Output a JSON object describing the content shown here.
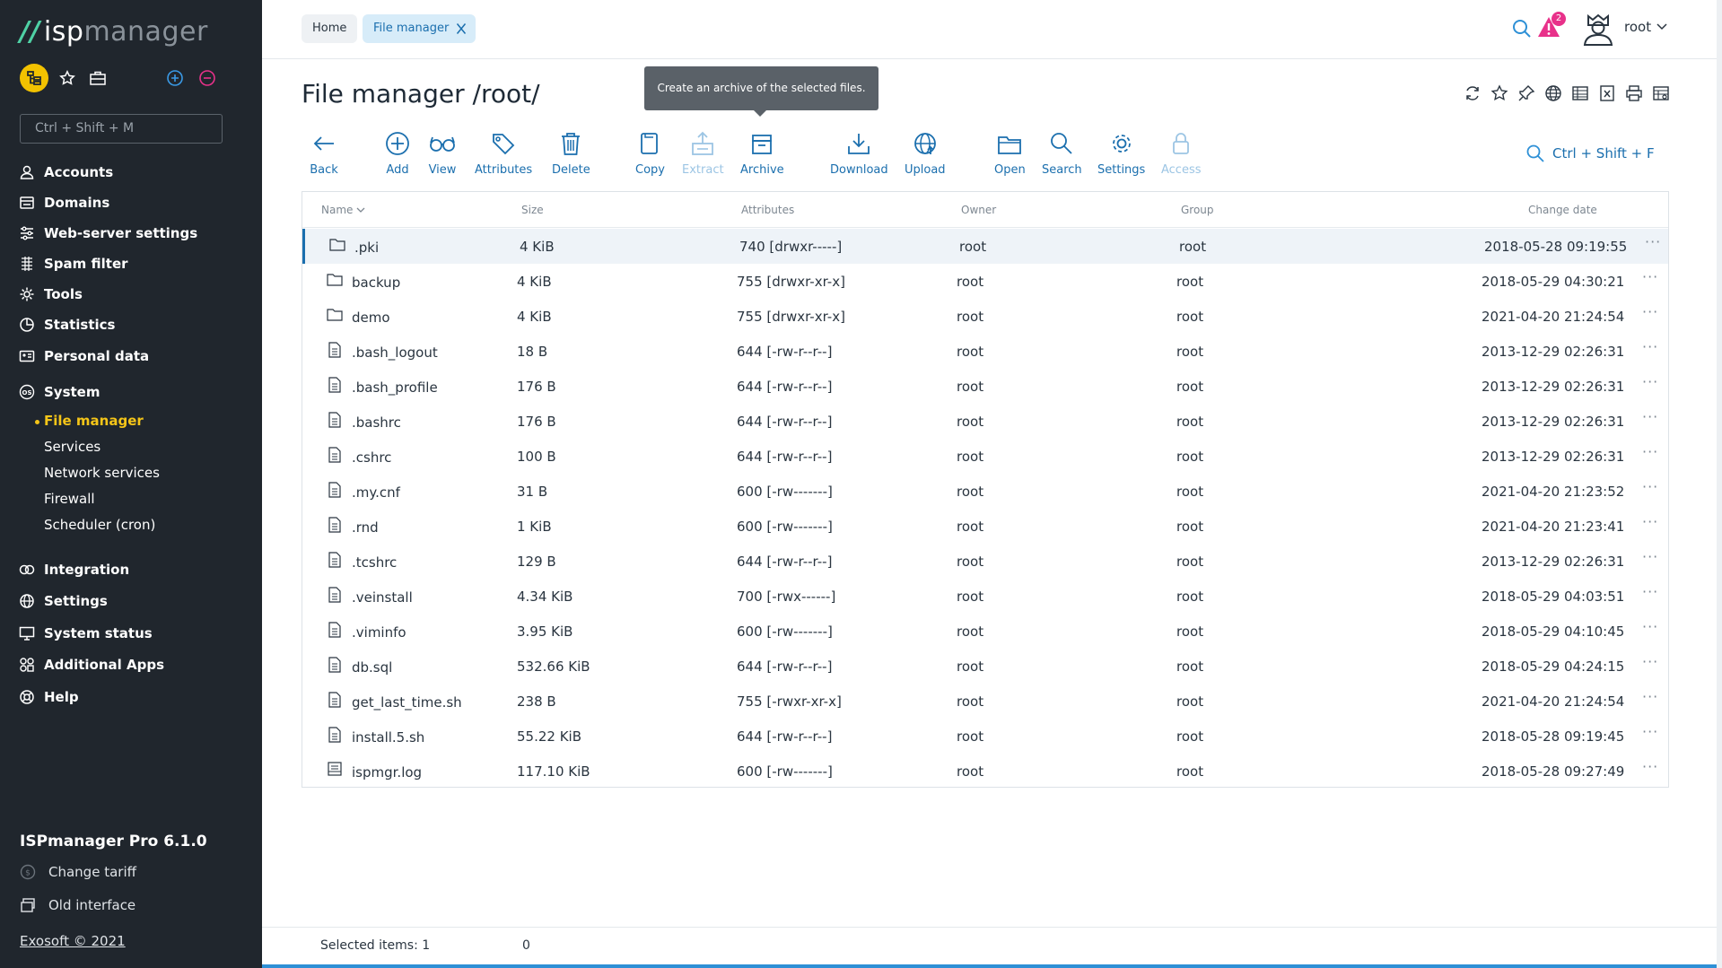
{
  "app": {
    "logo_isp": "isp",
    "logo_mgr": "manager",
    "search_placeholder": "Ctrl + Shift + M",
    "product": "ISPmanager Pro 6.1.0",
    "change_tariff": "Change tariff",
    "old_interface": "Old interface",
    "copyright": "Exosoft © 2021",
    "accent_color": "#f5c518",
    "link_color": "#1b6fae"
  },
  "menu": {
    "items": [
      {
        "label": "Accounts",
        "icon": "user-icon"
      },
      {
        "label": "Domains",
        "icon": "domains-icon"
      },
      {
        "label": "Web-server settings",
        "icon": "sliders-icon"
      },
      {
        "label": "Spam filter",
        "icon": "filter-icon"
      },
      {
        "label": "Tools",
        "icon": "gear-icon"
      },
      {
        "label": "Statistics",
        "icon": "pie-chart-icon"
      },
      {
        "label": "Personal data",
        "icon": "id-card-icon"
      },
      {
        "label": "System",
        "icon": "os-icon"
      },
      {
        "label": "Integration",
        "icon": "toggle-icon"
      },
      {
        "label": "Settings",
        "icon": "globe-gear-icon"
      },
      {
        "label": "System status",
        "icon": "monitor-icon"
      },
      {
        "label": "Additional Apps",
        "icon": "apps-icon"
      },
      {
        "label": "Help",
        "icon": "lifebuoy-icon"
      }
    ],
    "system_sub": [
      {
        "label": "File manager",
        "active": true
      },
      {
        "label": "Services",
        "active": false
      },
      {
        "label": "Network services",
        "active": false
      },
      {
        "label": "Firewall",
        "active": false
      },
      {
        "label": "Scheduler (cron)",
        "active": false
      }
    ]
  },
  "tabs": [
    {
      "label": "Home"
    },
    {
      "label": "File manager"
    }
  ],
  "user": {
    "name": "root",
    "alerts": "2"
  },
  "page": {
    "title": "File manager /root/",
    "tooltip": "Create an archive of the selected files.",
    "find_shortcut": "Ctrl + Shift + F"
  },
  "toolbar": [
    {
      "label": "Back",
      "icon": "arrow-left-icon",
      "disabled": false
    },
    {
      "label": "Add",
      "icon": "plus-circle-icon",
      "disabled": false
    },
    {
      "label": "View",
      "icon": "glasses-icon",
      "disabled": false
    },
    {
      "label": "Attributes",
      "icon": "tags-icon",
      "disabled": false
    },
    {
      "label": "Delete",
      "icon": "trash-icon",
      "disabled": false
    },
    {
      "label": "Copy",
      "icon": "copy-icon",
      "disabled": false
    },
    {
      "label": "Extract",
      "icon": "extract-icon",
      "disabled": true
    },
    {
      "label": "Archive",
      "icon": "archive-icon",
      "disabled": false
    },
    {
      "label": "Download",
      "icon": "download-icon",
      "disabled": false
    },
    {
      "label": "Upload",
      "icon": "upload-icon",
      "disabled": false
    },
    {
      "label": "Open",
      "icon": "folder-open-icon",
      "disabled": false
    },
    {
      "label": "Search",
      "icon": "search-icon",
      "disabled": false
    },
    {
      "label": "Settings",
      "icon": "gear-icon",
      "disabled": false
    },
    {
      "label": "Access",
      "icon": "lock-icon",
      "disabled": true
    }
  ],
  "table": {
    "columns": [
      "Name",
      "Size",
      "Attributes",
      "Owner",
      "Group",
      "Change date"
    ],
    "rows": [
      {
        "name": ".pki",
        "type": "folder",
        "size": "4 KiB",
        "attrs": "740 [drwxr-----]",
        "owner": "root",
        "group": "root",
        "date": "2018-05-28 09:19:55",
        "selected": true
      },
      {
        "name": "backup",
        "type": "folder",
        "size": "4 KiB",
        "attrs": "755 [drwxr-xr-x]",
        "owner": "root",
        "group": "root",
        "date": "2018-05-29 04:30:21"
      },
      {
        "name": "demo",
        "type": "folder",
        "size": "4 KiB",
        "attrs": "755 [drwxr-xr-x]",
        "owner": "root",
        "group": "root",
        "date": "2021-04-20 21:24:54"
      },
      {
        "name": ".bash_logout",
        "type": "file",
        "size": "18 B",
        "attrs": "644 [-rw-r--r--]",
        "owner": "root",
        "group": "root",
        "date": "2013-12-29 02:26:31"
      },
      {
        "name": ".bash_profile",
        "type": "file",
        "size": "176 B",
        "attrs": "644 [-rw-r--r--]",
        "owner": "root",
        "group": "root",
        "date": "2013-12-29 02:26:31"
      },
      {
        "name": ".bashrc",
        "type": "file",
        "size": "176 B",
        "attrs": "644 [-rw-r--r--]",
        "owner": "root",
        "group": "root",
        "date": "2013-12-29 02:26:31"
      },
      {
        "name": ".cshrc",
        "type": "file",
        "size": "100 B",
        "attrs": "644 [-rw-r--r--]",
        "owner": "root",
        "group": "root",
        "date": "2013-12-29 02:26:31"
      },
      {
        "name": ".my.cnf",
        "type": "file",
        "size": "31 B",
        "attrs": "600 [-rw-------]",
        "owner": "root",
        "group": "root",
        "date": "2021-04-20 21:23:52"
      },
      {
        "name": ".rnd",
        "type": "file",
        "size": "1 KiB",
        "attrs": "600 [-rw-------]",
        "owner": "root",
        "group": "root",
        "date": "2021-04-20 21:23:41"
      },
      {
        "name": ".tcshrc",
        "type": "file",
        "size": "129 B",
        "attrs": "644 [-rw-r--r--]",
        "owner": "root",
        "group": "root",
        "date": "2013-12-29 02:26:31"
      },
      {
        "name": ".veinstall",
        "type": "file",
        "size": "4.34 KiB",
        "attrs": "700 [-rwx------]",
        "owner": "root",
        "group": "root",
        "date": "2018-05-29 04:03:51"
      },
      {
        "name": ".viminfo",
        "type": "file",
        "size": "3.95 KiB",
        "attrs": "600 [-rw-------]",
        "owner": "root",
        "group": "root",
        "date": "2018-05-29 04:10:45"
      },
      {
        "name": "db.sql",
        "type": "file",
        "size": "532.66 KiB",
        "attrs": "644 [-rw-r--r--]",
        "owner": "root",
        "group": "root",
        "date": "2018-05-29 04:24:15"
      },
      {
        "name": "get_last_time.sh",
        "type": "file",
        "size": "238 B",
        "attrs": "755 [-rwxr-xr-x]",
        "owner": "root",
        "group": "root",
        "date": "2021-04-20 21:24:54"
      },
      {
        "name": "install.5.sh",
        "type": "file",
        "size": "55.22 KiB",
        "attrs": "644 [-rw-r--r--]",
        "owner": "root",
        "group": "root",
        "date": "2018-05-28 09:19:45"
      },
      {
        "name": "ispmgr.log",
        "type": "log",
        "size": "117.10 KiB",
        "attrs": "600 [-rw-------]",
        "owner": "root",
        "group": "root",
        "date": "2018-05-28 09:27:49"
      }
    ]
  },
  "status": {
    "selected_label": "Selected items: 1",
    "selected_size": "0"
  }
}
